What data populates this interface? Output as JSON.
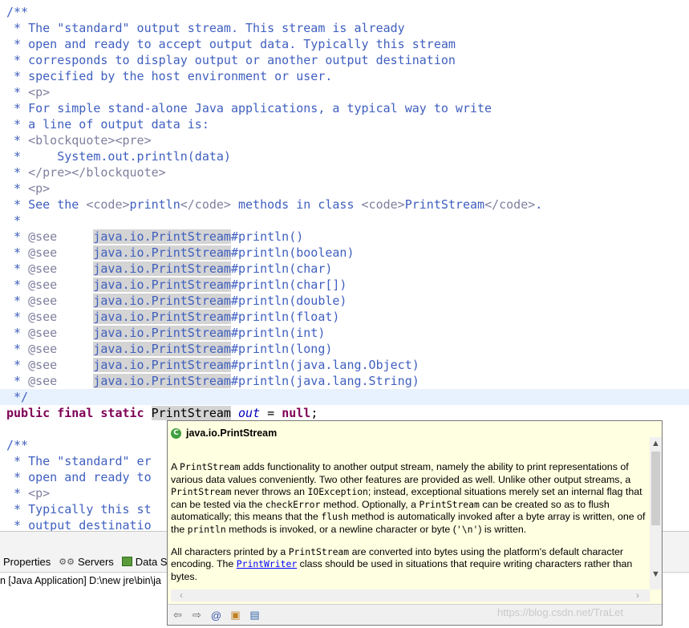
{
  "editor": {
    "lines": [
      {
        "text": "/**"
      },
      {
        "text": " * The \"standard\" output stream. This stream is already"
      },
      {
        "text": " * open and ready to accept output data. Typically this stream"
      },
      {
        "text": " * corresponds to display output or another output destination"
      },
      {
        "text": " * specified by the host environment or user."
      },
      {
        "text": " * ",
        "tag1": "<p>"
      },
      {
        "text": " * For simple stand-alone Java applications, a typical way to write"
      },
      {
        "text": " * a line of output data is:"
      },
      {
        "text": " * ",
        "tag1": "<blockquote><pre>"
      },
      {
        "text": " *     System.out.println(data)"
      },
      {
        "text": " * ",
        "tag1": "</pre></blockquote>"
      },
      {
        "text": " * ",
        "tag1": "<p>"
      }
    ],
    "see_line": {
      "pre": " * See the ",
      "code_open": "<code>",
      "word1": "println",
      "code_close": "</code>",
      "mid": " methods in class ",
      "code_open2": "<code>",
      "word2": "PrintStream",
      "code_close2": "</code>",
      "end": "."
    },
    "blank_line": " *",
    "see_tag": "@see",
    "see_prefix": "java.io.PrintStream",
    "see_items": [
      "#println()",
      "#println(boolean)",
      "#println(char)",
      "#println(char[])",
      "#println(double)",
      "#println(float)",
      "#println(int)",
      "#println(long)",
      "#println(java.lang.Object)",
      "#println(java.lang.String)"
    ],
    "close_comment": " */",
    "declaration": {
      "kw": "public final static",
      "type": "PrintStream",
      "field": "out",
      "eq": " = ",
      "null_kw": "null",
      "semi": ";"
    },
    "after_lines": [
      "/**",
      " * The \"standard\" er",
      " * open and ready to",
      " * <p>",
      " * Typically this st",
      " * output destinatio"
    ]
  },
  "bottom_panel": {
    "tabs": [
      "Properties",
      "Servers",
      "Data Sc"
    ],
    "console_line": "n [Java Application] D:\\new jre\\bin\\ja"
  },
  "hover": {
    "title": "java.io.PrintStream",
    "icon": "class-icon",
    "para1": [
      {
        "t": "A "
      },
      {
        "c": "PrintStream"
      },
      {
        "t": " adds functionality to another output stream, namely the ability to print representations of various data values conveniently. Two other features are provided as well. Unlike other output streams, a "
      },
      {
        "c": "PrintStream"
      },
      {
        "t": " never throws an "
      },
      {
        "c": "IOException"
      },
      {
        "t": "; instead, exceptional situations merely set an internal flag that can be tested via the "
      },
      {
        "c": "checkError"
      },
      {
        "t": " method. Optionally, a "
      },
      {
        "c": "PrintStream"
      },
      {
        "t": " can be created so as to flush automatically; this means that the "
      },
      {
        "c": "flush"
      },
      {
        "t": " method is automatically invoked after a byte array is written, one of the "
      },
      {
        "c": "println"
      },
      {
        "t": " methods is invoked, or a newline character or byte ("
      },
      {
        "c": "'\\n'"
      },
      {
        "t": ") is written."
      }
    ],
    "para2": [
      {
        "t": "All characters printed by a "
      },
      {
        "c": "PrintStream"
      },
      {
        "t": " are converted into bytes using the platform's default character encoding. The "
      },
      {
        "l": "PrintWriter"
      },
      {
        "t": " class should be used in situations that require writing characters rather than bytes."
      }
    ]
  },
  "watermark": "https://blog.csdn.net/TraLet"
}
